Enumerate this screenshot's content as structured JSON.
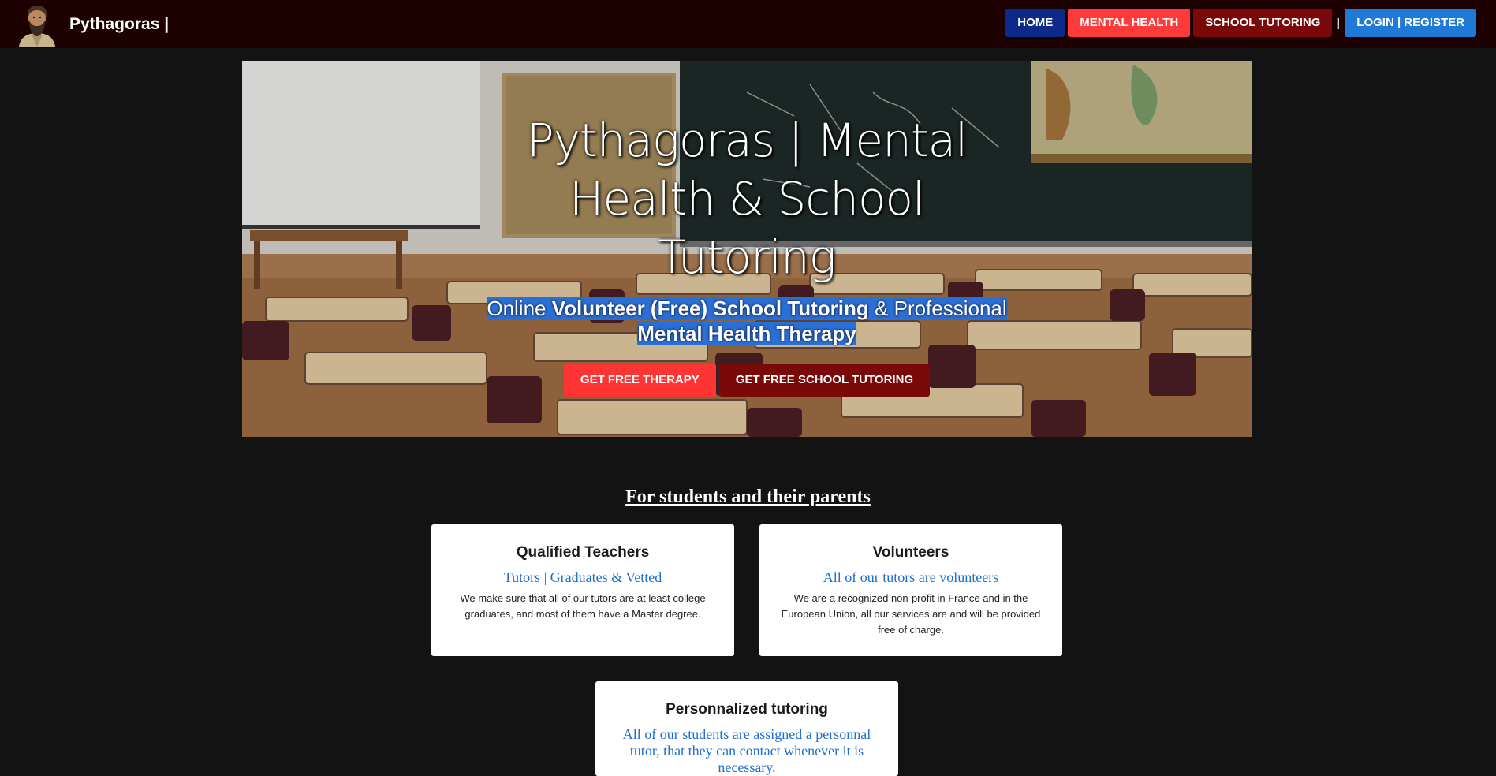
{
  "header": {
    "brand": "Pythagoras |",
    "nav": {
      "home": "HOME",
      "mental_health": "MENTAL HEALTH",
      "school_tutoring": "SCHOOL TUTORING",
      "separator": "|",
      "login": "LOGIN | REGISTER"
    }
  },
  "hero": {
    "title": "Pythagoras | Mental Health & School Tutoring",
    "subtitle": {
      "part1": "Online ",
      "part2": "Volunteer (Free) School Tutoring",
      "part3": " & Professional ",
      "part4": "Mental Health Therapy"
    },
    "buttons": {
      "therapy": "GET FREE THERAPY",
      "tutoring": "GET FREE SCHOOL TUTORING"
    }
  },
  "section": {
    "title": "For students and their parents",
    "cards": [
      {
        "title": "Qualified Teachers",
        "subtitle": "Tutors | Graduates & Vetted",
        "text": "We make sure that all of our tutors are at least college graduates, and most of them have a Master degree."
      },
      {
        "title": "Volunteers",
        "subtitle": "All of our tutors are volunteers",
        "text": "We are a recognized non-profit in France and in the European Union, all our services are and will be provided free of charge."
      },
      {
        "title": "Personnalized tutoring",
        "subtitle": "All of our students are assigned a personnal tutor, that they can contact whenever it is necessary."
      }
    ]
  },
  "colors": {
    "navbar_bg": "#1d0000",
    "page_bg": "#131313",
    "home_btn": "#0d2a8a",
    "mental_btn": "#ff3a3a",
    "school_btn": "#7a0a0a",
    "login_btn": "#1e7ad6",
    "accent_text": "#1e6fd0"
  },
  "icons": {
    "logo": "pythagoras-portrait-logo"
  }
}
